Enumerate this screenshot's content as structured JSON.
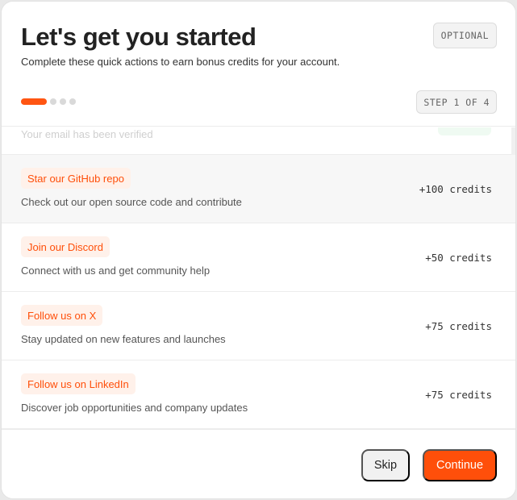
{
  "header": {
    "title": "Let's get you started",
    "subtitle": "Complete these quick actions to earn bonus credits for your account.",
    "optional_label": "OPTIONAL",
    "step_label": "STEP 1 OF 4"
  },
  "progress": {
    "current_step": 1,
    "total_steps": 4
  },
  "list": {
    "faded_item": {
      "description": "Your email has been verified"
    },
    "items": [
      {
        "tag": "Star our GitHub repo",
        "description": "Check out our open source code and contribute",
        "credits": "+100 credits"
      },
      {
        "tag": "Join our Discord",
        "description": "Connect with us and get community help",
        "credits": "+50 credits"
      },
      {
        "tag": "Follow us on X",
        "description": "Stay updated on new features and launches",
        "credits": "+75 credits"
      },
      {
        "tag": "Follow us on LinkedIn",
        "description": "Discover job opportunities and company updates",
        "credits": "+75 credits"
      }
    ]
  },
  "footer": {
    "skip_label": "Skip",
    "continue_label": "Continue"
  },
  "colors": {
    "accent": "#ff4f0a",
    "tag_bg": "#fff1ea",
    "inactive_dot": "#d9d9d9"
  }
}
